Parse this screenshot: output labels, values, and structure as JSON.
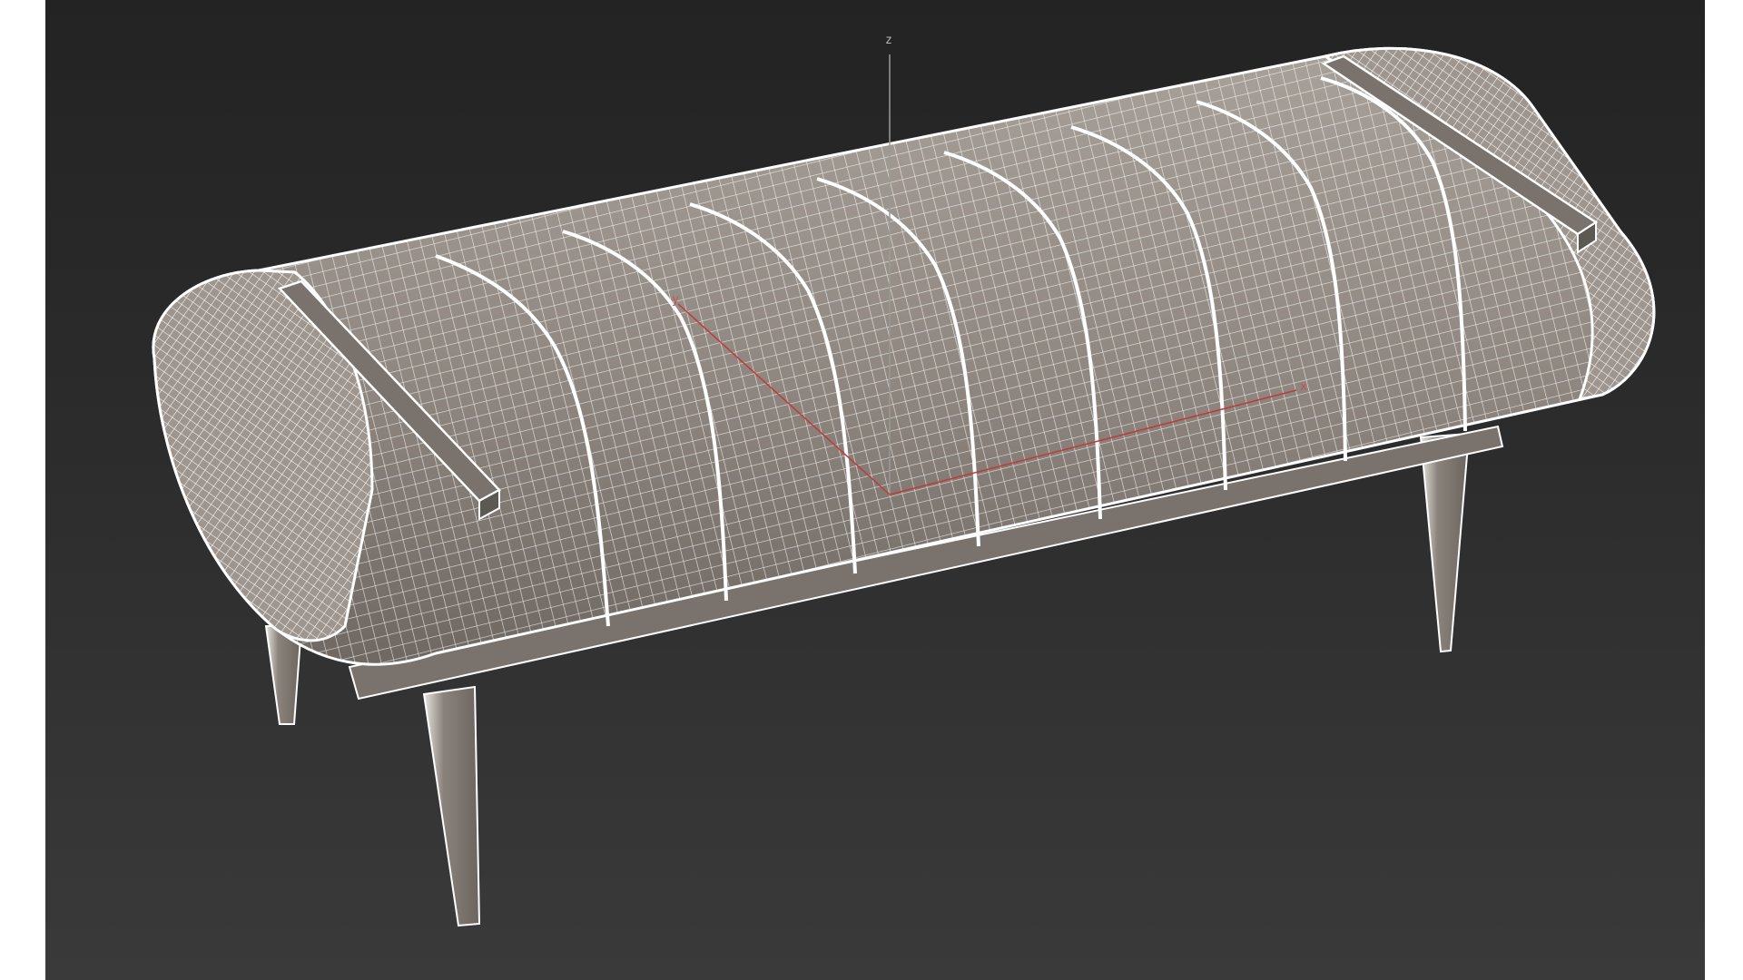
{
  "viewport": {
    "background_top": "#232323",
    "background_bottom": "#3a3a3a",
    "mesh_fill": "#8f8780",
    "wire_color": "#ffffff",
    "object": "bench-wireframe"
  },
  "gizmo": {
    "z_label": "z",
    "y_label": "y",
    "x_label": "x",
    "z_color": "#9a9a9a",
    "xy_color": "#c03a3a"
  }
}
